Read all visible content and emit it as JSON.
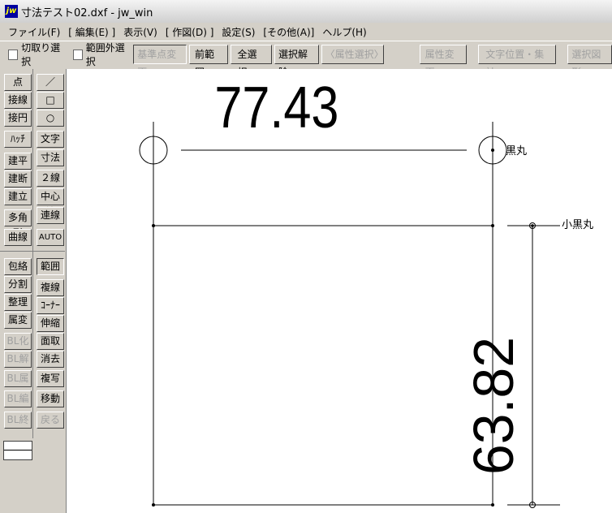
{
  "window": {
    "title": "寸法テスト02.dxf - jw_win",
    "logo": "jw"
  },
  "menu": [
    "ファイル(F)",
    "[ 編集(E) ]",
    "表示(V)",
    "[ 作図(D) ]",
    "設定(S)",
    "[その他(A)]",
    "ヘルプ(H)"
  ],
  "toolbar": {
    "checkbox_cut": "切取り選択",
    "checkbox_outside": "範囲外選択",
    "base_point": "基準点変更",
    "prev_range": "前範囲",
    "select_all": "全選択",
    "deselect": "選択解除",
    "attr_select": "〈属性選択〉",
    "attr_change": "属性変更",
    "text_pos": "文字位置・集計",
    "select_fig": "選択図形"
  },
  "left_tools": [
    "点",
    "接線",
    "接円",
    "ﾊｯﾁ",
    "建平",
    "建断",
    "建立",
    "多角形",
    "曲線",
    "包絡",
    "分割",
    "整理",
    "属変",
    "BL化",
    "BL解",
    "BL属",
    "BL編",
    "BL終"
  ],
  "right_tools": [
    "／",
    "□",
    "○",
    "文字",
    "寸法",
    "２線",
    "中心線",
    "連線",
    "AUTO",
    "範囲",
    "複線",
    "ｺｰﾅｰ",
    "伸縮",
    "面取",
    "消去",
    "複写",
    "移動",
    "戻る"
  ],
  "drawing": {
    "dim_horizontal": "77.43",
    "dim_vertical": "63.82",
    "label_black_circle": "黒丸",
    "label_small_black_circle": "小黒丸"
  }
}
